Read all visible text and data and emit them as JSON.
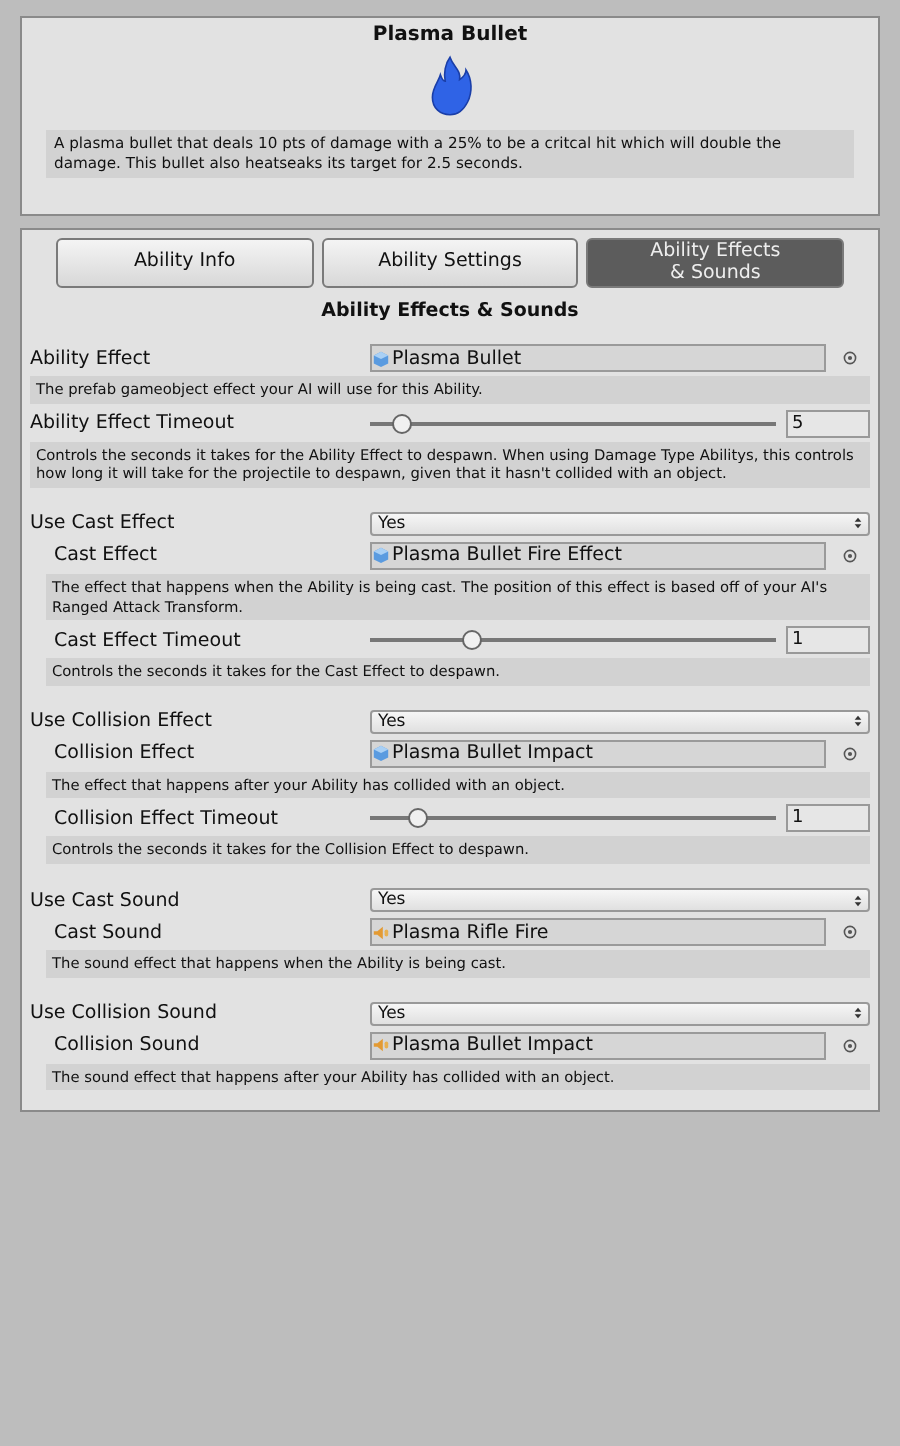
{
  "header": {
    "title": "Plasma Bullet",
    "description": "A plasma bullet that deals 10 pts of damage with a 25% to be a critcal hit which will double the damage. This bullet also heatseaks its target for 2.5 seconds."
  },
  "tabs": [
    {
      "label": "Ability Info",
      "selected": false
    },
    {
      "label": "Ability Settings",
      "selected": false
    },
    {
      "label": "Ability Effects\n& Sounds",
      "selected": true
    }
  ],
  "section_title": "Ability Effects & Sounds",
  "rows": [
    {
      "kind": "object",
      "label": "Ability Effect",
      "value": "Plasma Bullet",
      "icon": {
        "kind": "prefab"
      }
    },
    {
      "kind": "help",
      "text": "The prefab gameobject effect your AI will use for this Ability."
    },
    {
      "kind": "slider",
      "label": "Ability Effect Timeout",
      "level": 0.08,
      "value": "5"
    },
    {
      "kind": "help",
      "text": "Controls the seconds it takes for the Ability Effect to despawn. When using Damage Type Abilitys, this controls how long it will take for the projectile to despawn, given that it hasn't collided with an object."
    },
    {
      "kind": "dropdown",
      "label": "Use Cast Effect",
      "value": "Yes",
      "children": [
        {
          "kind": "object",
          "label": "Cast Effect",
          "value": "Plasma Bullet Fire Effect",
          "icon": {
            "kind": "prefab"
          }
        },
        {
          "kind": "help",
          "text": "The effect that happens when the Ability is being cast. The position of this effect is based off of your AI's Ranged Attack Transform."
        },
        {
          "kind": "slider",
          "label": "Cast Effect Timeout",
          "level": 0.25,
          "value": "1"
        },
        {
          "kind": "help",
          "text": "Controls the seconds it takes for the Cast Effect to despawn."
        }
      ]
    },
    {
      "kind": "dropdown",
      "label": "Use Collision Effect",
      "value": "Yes",
      "children": [
        {
          "kind": "object",
          "label": "Collision Effect",
          "value": "Plasma Bullet Impact",
          "icon": {
            "kind": "prefab"
          }
        },
        {
          "kind": "help",
          "text": "The effect that happens after your Ability has collided with an object."
        },
        {
          "kind": "slider",
          "label": "Collision Effect Timeout",
          "level": 0.12,
          "value": "1"
        },
        {
          "kind": "help",
          "text": "Controls the seconds it takes for the Collision Effect to despawn."
        }
      ]
    },
    {
      "kind": "dropdown",
      "label": "Use Cast Sound",
      "value": "Yes",
      "children": [
        {
          "kind": "object",
          "label": "Cast Sound",
          "value": "Plasma Rifle Fire",
          "icon": {
            "kind": "audio"
          }
        },
        {
          "kind": "help",
          "text": "The sound effect that happens when the Ability is being cast."
        }
      ]
    },
    {
      "kind": "dropdown",
      "label": "Use Collision Sound",
      "value": "Yes",
      "children": [
        {
          "kind": "object",
          "label": "Collision Sound",
          "value": "Plasma Bullet Impact",
          "icon": {
            "kind": "audio"
          }
        },
        {
          "kind": "help",
          "text": "The sound effect that happens after your Ability has collided with an object."
        }
      ]
    }
  ]
}
